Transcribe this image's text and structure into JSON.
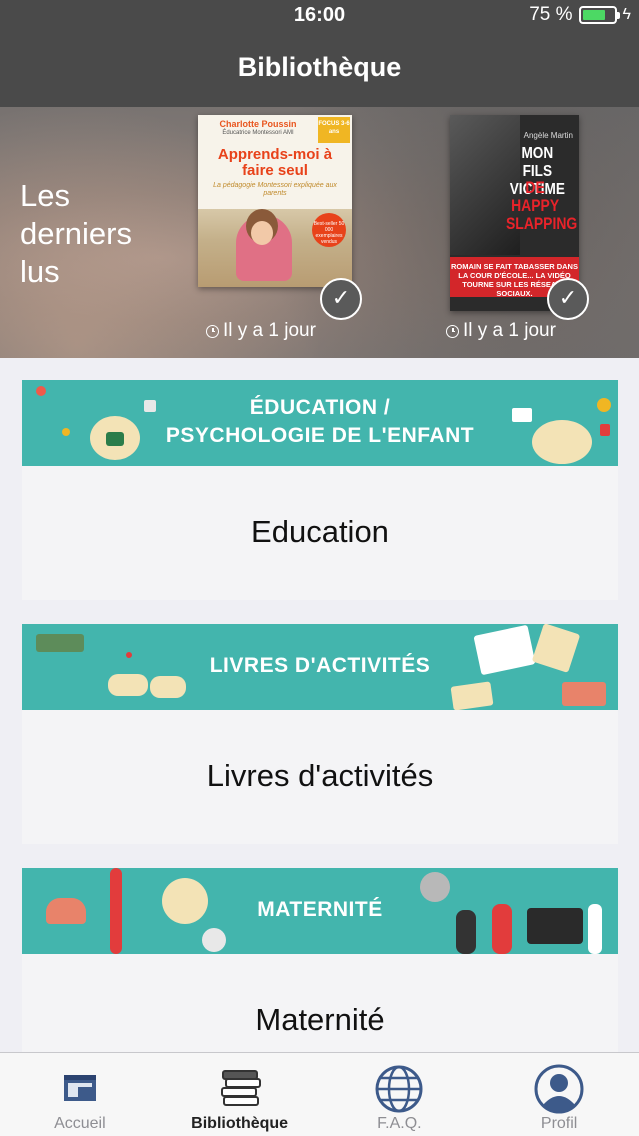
{
  "status": {
    "time": "16:00",
    "battery": "75 %",
    "battery_level": 0.75
  },
  "header": {
    "title": "Bibliothèque"
  },
  "recent": {
    "label": "Les\nderniers\nlus",
    "books": [
      {
        "author": "Charlotte Poussin",
        "subtitle": "Éducatrice Montessori AMI",
        "badge": "FOCUS 3-6 ans",
        "title": "Apprends-moi à faire seul",
        "tagline": "La pédagogie Montessori expliquée aux parents",
        "burst": "Best-seller 50 000 exemplaires vendus",
        "time": "Il y a 1 jour"
      },
      {
        "author": "Angèle Martin",
        "title_white": "MON FILS VICTIME",
        "title_red": "DE HAPPY SLAPPING",
        "banner": "ROMAIN SE FAIT TABASSER DANS LA COUR D'ÉCOLE... LA VIDÉO TOURNE SUR LES RÉSEAUX SOCIAUX.",
        "time": "Il y a 1 jour"
      }
    ]
  },
  "categories": [
    {
      "banner": "ÉDUCATION /\nPSYCHOLOGIE DE L'ENFANT",
      "label": "Education"
    },
    {
      "banner": "LIVRES D'ACTIVITÉS",
      "label": "Livres d'activités"
    },
    {
      "banner": "MATERNITÉ",
      "label": "Maternité"
    }
  ],
  "tabs": [
    {
      "label": "Accueil",
      "icon": "home-screen-icon"
    },
    {
      "label": "Bibliothèque",
      "icon": "books-stack-icon",
      "active": true
    },
    {
      "label": "F.A.Q.",
      "icon": "globe-icon"
    },
    {
      "label": "Profil",
      "icon": "profile-icon"
    }
  ],
  "colors": {
    "header": "#4a4a4a",
    "banner": "#43b5ad",
    "tab_active": "#222222",
    "tab_inactive": "#8e8e93",
    "icon_blue": "#3d5a8a"
  }
}
